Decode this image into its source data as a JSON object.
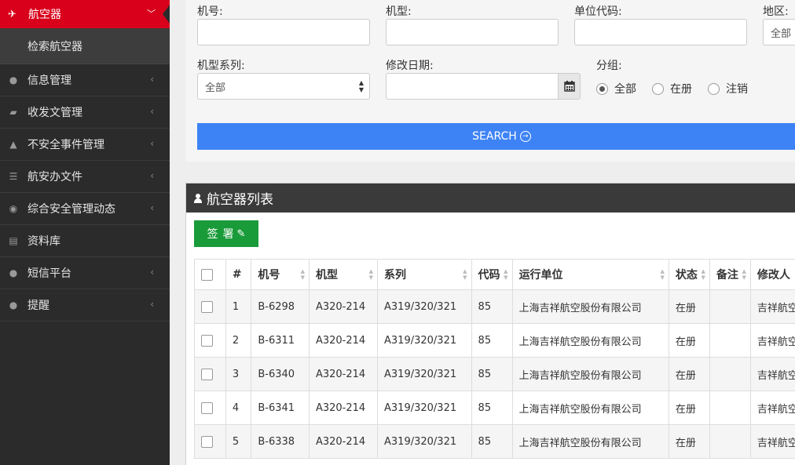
{
  "sidebar": {
    "active": {
      "label": "航空器",
      "icon": "plane-icon"
    },
    "sub_item": "检索航空器",
    "items": [
      {
        "label": "信息管理",
        "icon": "map-marker-icon"
      },
      {
        "label": "收发文管理",
        "icon": "folder-open-icon"
      },
      {
        "label": "不安全事件管理",
        "icon": "warning-icon"
      },
      {
        "label": "航安办文件",
        "icon": "list-icon"
      },
      {
        "label": "综合安全管理动态",
        "icon": "globe-icon"
      },
      {
        "label": "资料库",
        "icon": "book-icon"
      },
      {
        "label": "短信平台",
        "icon": "map-marker-icon"
      },
      {
        "label": "提醒",
        "icon": "map-marker-icon"
      }
    ]
  },
  "search": {
    "reg_label": "机号:",
    "reg_value": "",
    "model_label": "机型:",
    "model_value": "",
    "unit_label": "单位代码:",
    "unit_value": "",
    "region_label": "地区:",
    "region_value": "全部",
    "series_label": "机型系列:",
    "series_value": "全部",
    "date_label": "修改日期:",
    "date_value": "",
    "group_label": "分组:",
    "group_options": [
      "全部",
      "在册",
      "注销"
    ],
    "group_selected": "全部",
    "search_button": "SEARCH"
  },
  "list": {
    "title": "航空器列表",
    "sign_button": "签署",
    "columns": [
      "#",
      "机号",
      "机型",
      "系列",
      "代码",
      "运行单位",
      "状态",
      "备注",
      "修改人"
    ],
    "rows": [
      {
        "no": "1",
        "reg": "B-6298",
        "model": "A320-214",
        "series": "A319/320/321",
        "code": "85",
        "operator": "上海吉祥航空股份有限公司",
        "status": "在册",
        "note": "",
        "modifier": "吉祥航空"
      },
      {
        "no": "2",
        "reg": "B-6311",
        "model": "A320-214",
        "series": "A319/320/321",
        "code": "85",
        "operator": "上海吉祥航空股份有限公司",
        "status": "在册",
        "note": "",
        "modifier": "吉祥航空"
      },
      {
        "no": "3",
        "reg": "B-6340",
        "model": "A320-214",
        "series": "A319/320/321",
        "code": "85",
        "operator": "上海吉祥航空股份有限公司",
        "status": "在册",
        "note": "",
        "modifier": "吉祥航空"
      },
      {
        "no": "4",
        "reg": "B-6341",
        "model": "A320-214",
        "series": "A319/320/321",
        "code": "85",
        "operator": "上海吉祥航空股份有限公司",
        "status": "在册",
        "note": "",
        "modifier": "吉祥航空"
      },
      {
        "no": "5",
        "reg": "B-6338",
        "model": "A320-214",
        "series": "A319/320/321",
        "code": "85",
        "operator": "上海吉祥航空股份有限公司",
        "status": "在册",
        "note": "",
        "modifier": "吉祥航空"
      }
    ]
  },
  "colors": {
    "active_nav": "#d9001b",
    "search_button": "#3e83f5",
    "sign_button": "#1a9b3a",
    "sidebar": "#2b2b2b",
    "list_header": "#3a3a3a"
  }
}
